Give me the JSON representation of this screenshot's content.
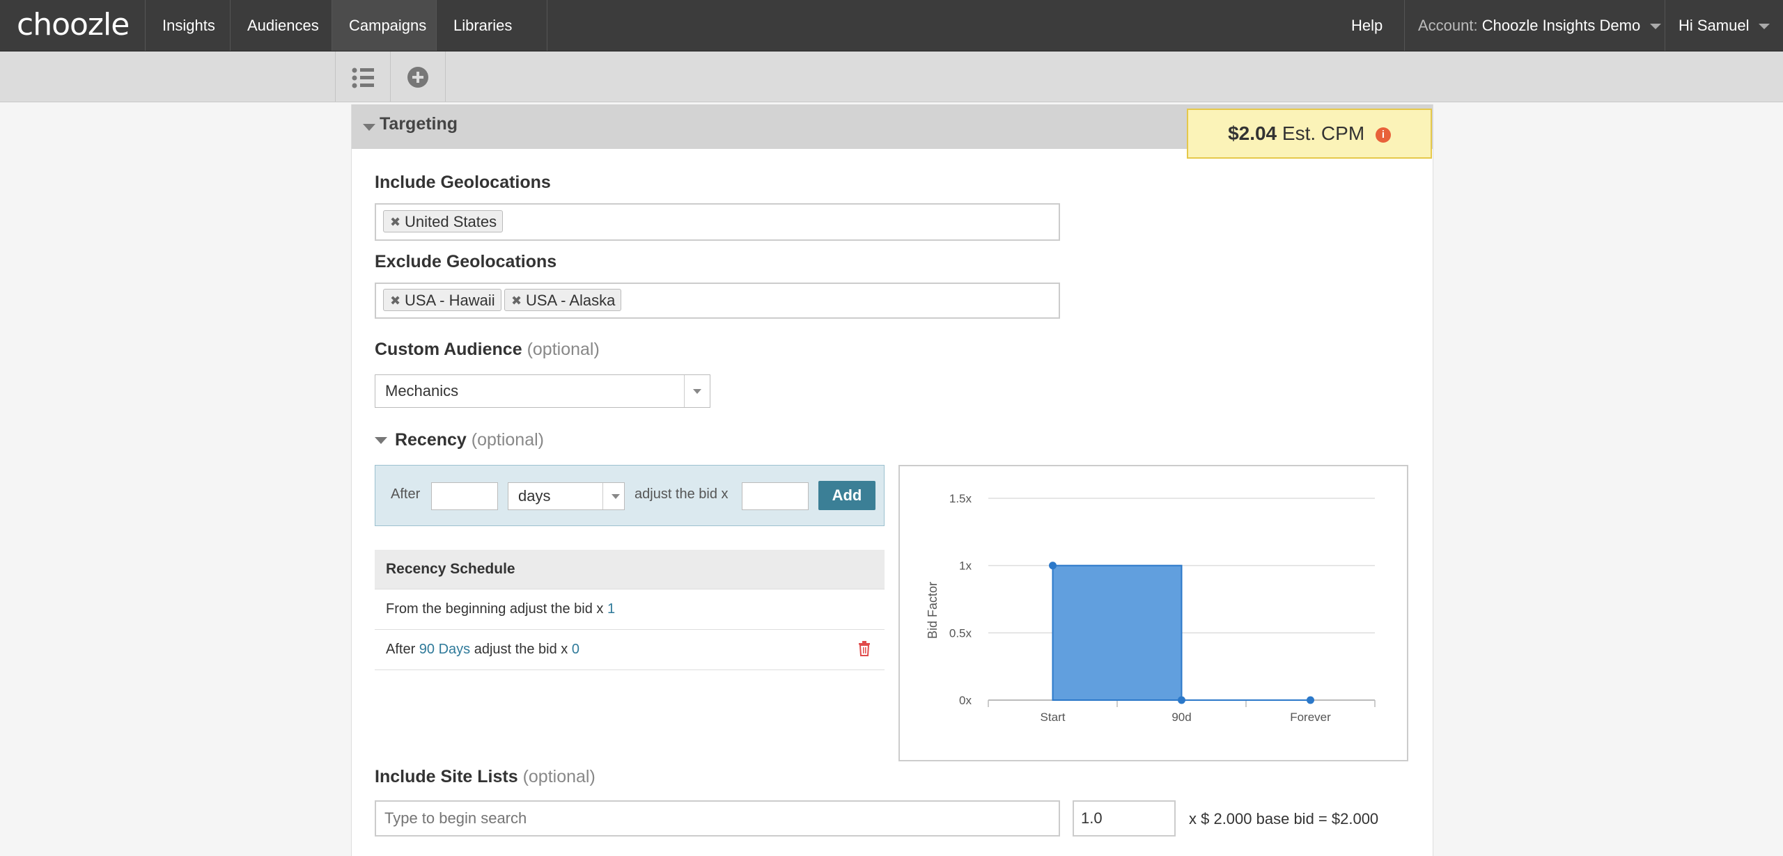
{
  "nav": {
    "logo": "choozle",
    "items": [
      {
        "label": "Insights"
      },
      {
        "label": "Audiences"
      },
      {
        "label": "Campaigns"
      },
      {
        "label": "Libraries"
      }
    ],
    "help": "Help",
    "account_prefix": "Account:",
    "account_name": "Choozle Insights Demo",
    "greeting": "Hi Samuel"
  },
  "toolbar": {
    "list_icon": "list-icon",
    "add_icon": "plus-circle-icon"
  },
  "targeting": {
    "title": "Targeting",
    "cpm_value": "$2.04",
    "cpm_label": "Est. CPM",
    "cpm_info": "i",
    "include_geo": {
      "label": "Include Geolocations",
      "tags": [
        "United States"
      ]
    },
    "exclude_geo": {
      "label": "Exclude Geolocations",
      "tags": [
        "USA - Hawaii",
        "USA - Alaska"
      ]
    },
    "custom_audience": {
      "label": "Custom Audience",
      "optional": "(optional)",
      "value": "Mechanics"
    },
    "recency": {
      "label": "Recency",
      "optional": "(optional)",
      "after_label": "After",
      "after_value": "",
      "unit": "days",
      "adjust_label": "adjust the bid x",
      "bid_value": "",
      "add_button": "Add",
      "schedule_title": "Recency Schedule",
      "rows": [
        {
          "prefix": "From the beginning adjust the bid x ",
          "mid": "",
          "mid_suffix": "",
          "value": "1"
        },
        {
          "prefix": "After ",
          "mid": "90 Days",
          "mid_suffix": " adjust the bid x ",
          "value": "0"
        }
      ]
    },
    "site_lists": {
      "label": "Include Site Lists",
      "optional": "(optional)",
      "placeholder": "Type to begin search",
      "multiplier": "1.0",
      "suffix": "x $ 2.000 base bid = $2.000"
    }
  },
  "colors": {
    "accent": "#3b7f96",
    "bar": "#619fde",
    "line": "#2b78c9",
    "cpm_bg": "#fbf3b8",
    "delete": "#e04b4b"
  },
  "chart_data": {
    "type": "area",
    "ylabel": "Bid Factor",
    "xlabel": "",
    "categories": [
      "Start",
      "90d",
      "Forever"
    ],
    "yticks": [
      "0x",
      "0.5x",
      "1x",
      "1.5x"
    ],
    "ylim": [
      0,
      1.5
    ],
    "series": [
      {
        "values": [
          1,
          0,
          0
        ]
      }
    ],
    "grid": true,
    "step": true
  }
}
